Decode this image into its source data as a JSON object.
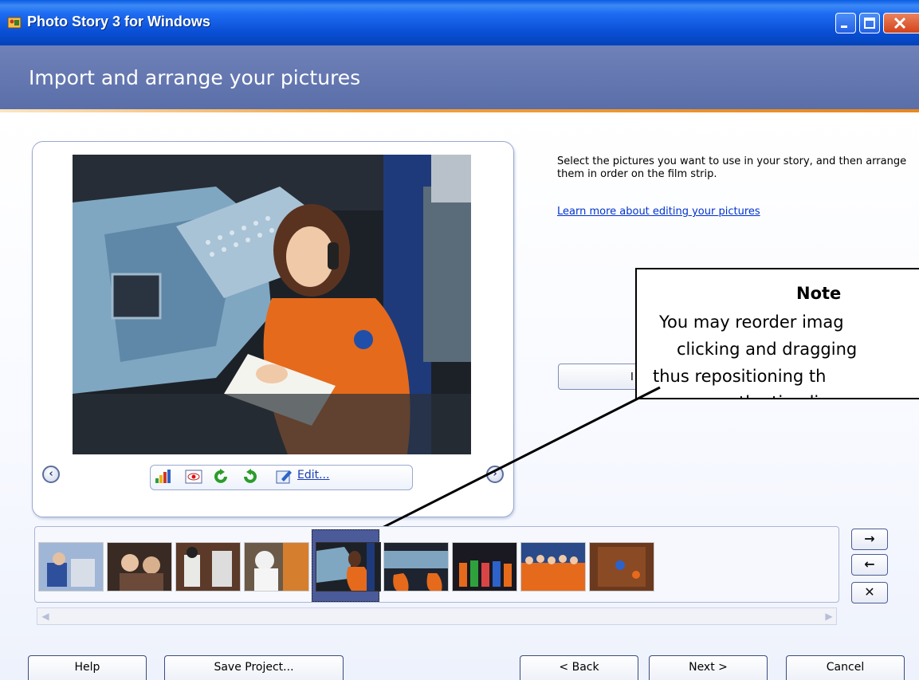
{
  "window": {
    "title": "Photo Story 3 for Windows"
  },
  "header": {
    "title": "Import and arrange your pictures"
  },
  "preview": {
    "edit_label": "Edit...",
    "tools": [
      "auto-fix-icon",
      "red-eye-icon",
      "rotate-left-icon",
      "rotate-right-icon",
      "edit-icon"
    ],
    "nav_prev": "‹",
    "nav_next": "›"
  },
  "instructions": {
    "text": "Select the pictures you want to use in your story, and then arrange them in order on the film strip.",
    "learn_more": "Learn more about editing your pictures",
    "import_button": "I"
  },
  "note": {
    "title": "Note",
    "lines": [
      "You may reorder imag",
      "clicking and dragging",
      "thus repositioning th",
      "the timeline."
    ]
  },
  "filmstrip": {
    "count": 9,
    "selected_index": 4,
    "side_buttons": [
      "→",
      "←",
      "✕"
    ]
  },
  "bottom_buttons": {
    "help": "Help",
    "save": "Save Project...",
    "back": "< Back",
    "next": "Next >",
    "cancel": "Cancel"
  },
  "colors": {
    "titlebar": "#0a4fd6",
    "header": "#5a6ea9",
    "accent_line": "#e8881c",
    "selection": "#4b5a99",
    "link": "#0033cc"
  }
}
